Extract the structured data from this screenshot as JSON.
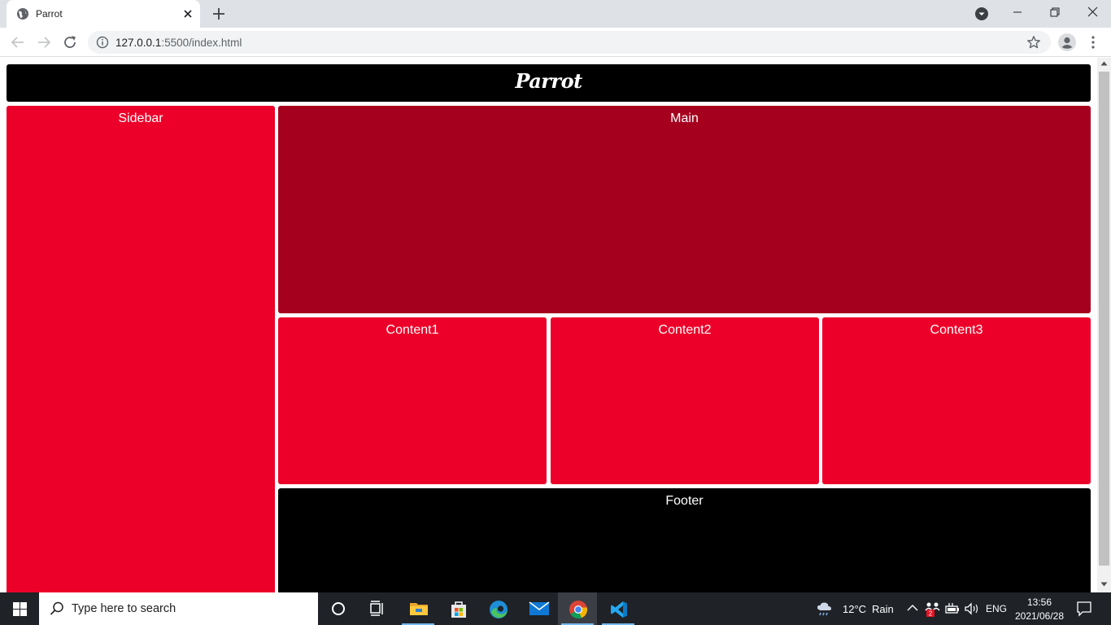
{
  "browser": {
    "tab": {
      "title": "Parrot"
    },
    "address": {
      "host": "127.0.0.1",
      "path": ":5500/index.html"
    }
  },
  "page": {
    "header": {
      "logo": "Parrot"
    },
    "sidebar": {
      "label": "Sidebar"
    },
    "main": {
      "label": "Main"
    },
    "contents": [
      {
        "label": "Content1"
      },
      {
        "label": "Content2"
      },
      {
        "label": "Content3"
      }
    ],
    "footer": {
      "label": "Footer"
    },
    "colors": {
      "header": "#000000",
      "sidebar": "#ec0029",
      "main": "#a6001f",
      "content": "#ec0029",
      "footer": "#000000"
    }
  },
  "taskbar": {
    "search_placeholder": "Type here to search",
    "apps": [
      "cortana-icon",
      "task-view-icon",
      "file-explorer-icon",
      "store-icon",
      "edge-icon",
      "mail-icon",
      "chrome-icon",
      "vscode-icon"
    ],
    "weather": {
      "temp": "12°C",
      "condition": "Rain"
    },
    "language": "ENG",
    "time": "13:56",
    "date": "2021/06/28",
    "notification_badge": "2"
  }
}
